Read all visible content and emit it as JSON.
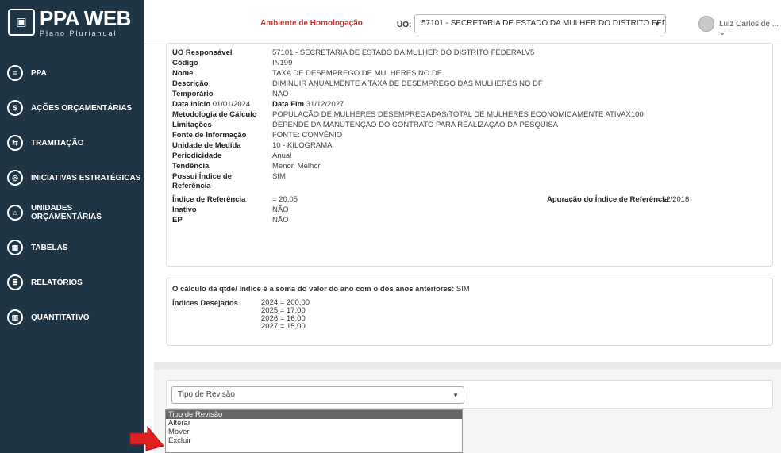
{
  "logo": {
    "title": "PPA WEB",
    "subtitle": "Plano Plurianual"
  },
  "header": {
    "env": "Ambiente de Homologação",
    "uo_label": "UO:",
    "uo_value": "57101 - SECRETARIA DE ESTADO DA MULHER DO DISTRITO FEDERAL",
    "user": "Luiz Carlos de ..."
  },
  "nav": [
    {
      "label": "PPA",
      "icon": "document-icon",
      "glyph": "≡"
    },
    {
      "label": "AÇÕES ORÇAMENTÁRIAS",
      "icon": "dollar-icon",
      "glyph": "$"
    },
    {
      "label": "TRAMITAÇÃO",
      "icon": "flow-icon",
      "glyph": "⇆"
    },
    {
      "label": "INICIATIVAS ESTRATÉGICAS",
      "icon": "target-icon",
      "glyph": "◎"
    },
    {
      "label": "UNIDADES ORÇAMENTÁRIAS",
      "icon": "building-icon",
      "glyph": "⌂"
    },
    {
      "label": "TABELAS",
      "icon": "table-icon",
      "glyph": "▦"
    },
    {
      "label": "RELATÓRIOS",
      "icon": "report-icon",
      "glyph": "≣"
    },
    {
      "label": "QUANTITATIVO",
      "icon": "chart-icon",
      "glyph": "▥"
    }
  ],
  "detail": {
    "uo_resp_label": "UO Responsável",
    "uo_resp": "57101 - SECRETARIA DE ESTADO DA MULHER DO DISTRITO FEDERALV5",
    "codigo_label": "Código",
    "codigo": "IN199",
    "nome_label": "Nome",
    "nome": "TAXA DE DESEMPREGO DE MULHERES NO DF",
    "descricao_label": "Descrição",
    "descricao": "DIMINUIR ANUALMENTE A TAXA DE DESEMPREGO DAS MULHERES NO DF",
    "temporario_label": "Temporário",
    "temporario": "NÃO",
    "data_inicio_label": "Data Início",
    "data_inicio": "01/01/2024",
    "data_fim_label": "Data Fim",
    "data_fim": "31/12/2027",
    "metodologia_label": "Metodologia de Cálculo",
    "metodologia": "POPULAÇÃO DE MULHERES DESEMPREGADAS/TOTAL DE MULHERES ECONOMICAMENTE ATIVAX100",
    "limitacoes_label": "Limitações",
    "limitacoes": "DEPENDE DA MANUTENÇÃO DO CONTRATO PARA REALIZAÇÃO DA PESQUISA",
    "fonte_label": "Fonte de Informação",
    "fonte": "FONTE: CONVÊNIO",
    "unidade_label": "Unidade de Medida",
    "unidade": "10 - KILOGRAMA",
    "periodicidade_label": "Periodicidade",
    "periodicidade": "Anual",
    "tendencia_label": "Tendência",
    "tendencia": "Menor, Melhor",
    "possui_label": "Possui Índice de Referência",
    "possui": "SIM",
    "indice_ref_label": "Índice de Referência",
    "indice_ref": "= 20,05",
    "apuracao_label": "Apuração do Índice de Referência",
    "apuracao": "12/2018",
    "inativo_label": "Inativo",
    "inativo": "NÃO",
    "ep_label": "EP",
    "ep": "NÃO"
  },
  "calc": {
    "text": "O cálculo da qtde/ índice é a soma do valor do ano com o dos anos anteriores:",
    "value": "SIM",
    "indices_label": "Índices Desejados",
    "indices": [
      "2024  =  200,00",
      "2025  =  17,00",
      "2026  =  16,00",
      "2027  =  15,00"
    ]
  },
  "revisao": {
    "selected": "Tipo de Revisão",
    "options": [
      "Tipo de Revisão",
      "Alterar",
      "Mover",
      "Excluir"
    ]
  },
  "colors": {
    "sidebar": "#1d3545",
    "env": "#d62f2f",
    "arrow": "#e02020"
  }
}
